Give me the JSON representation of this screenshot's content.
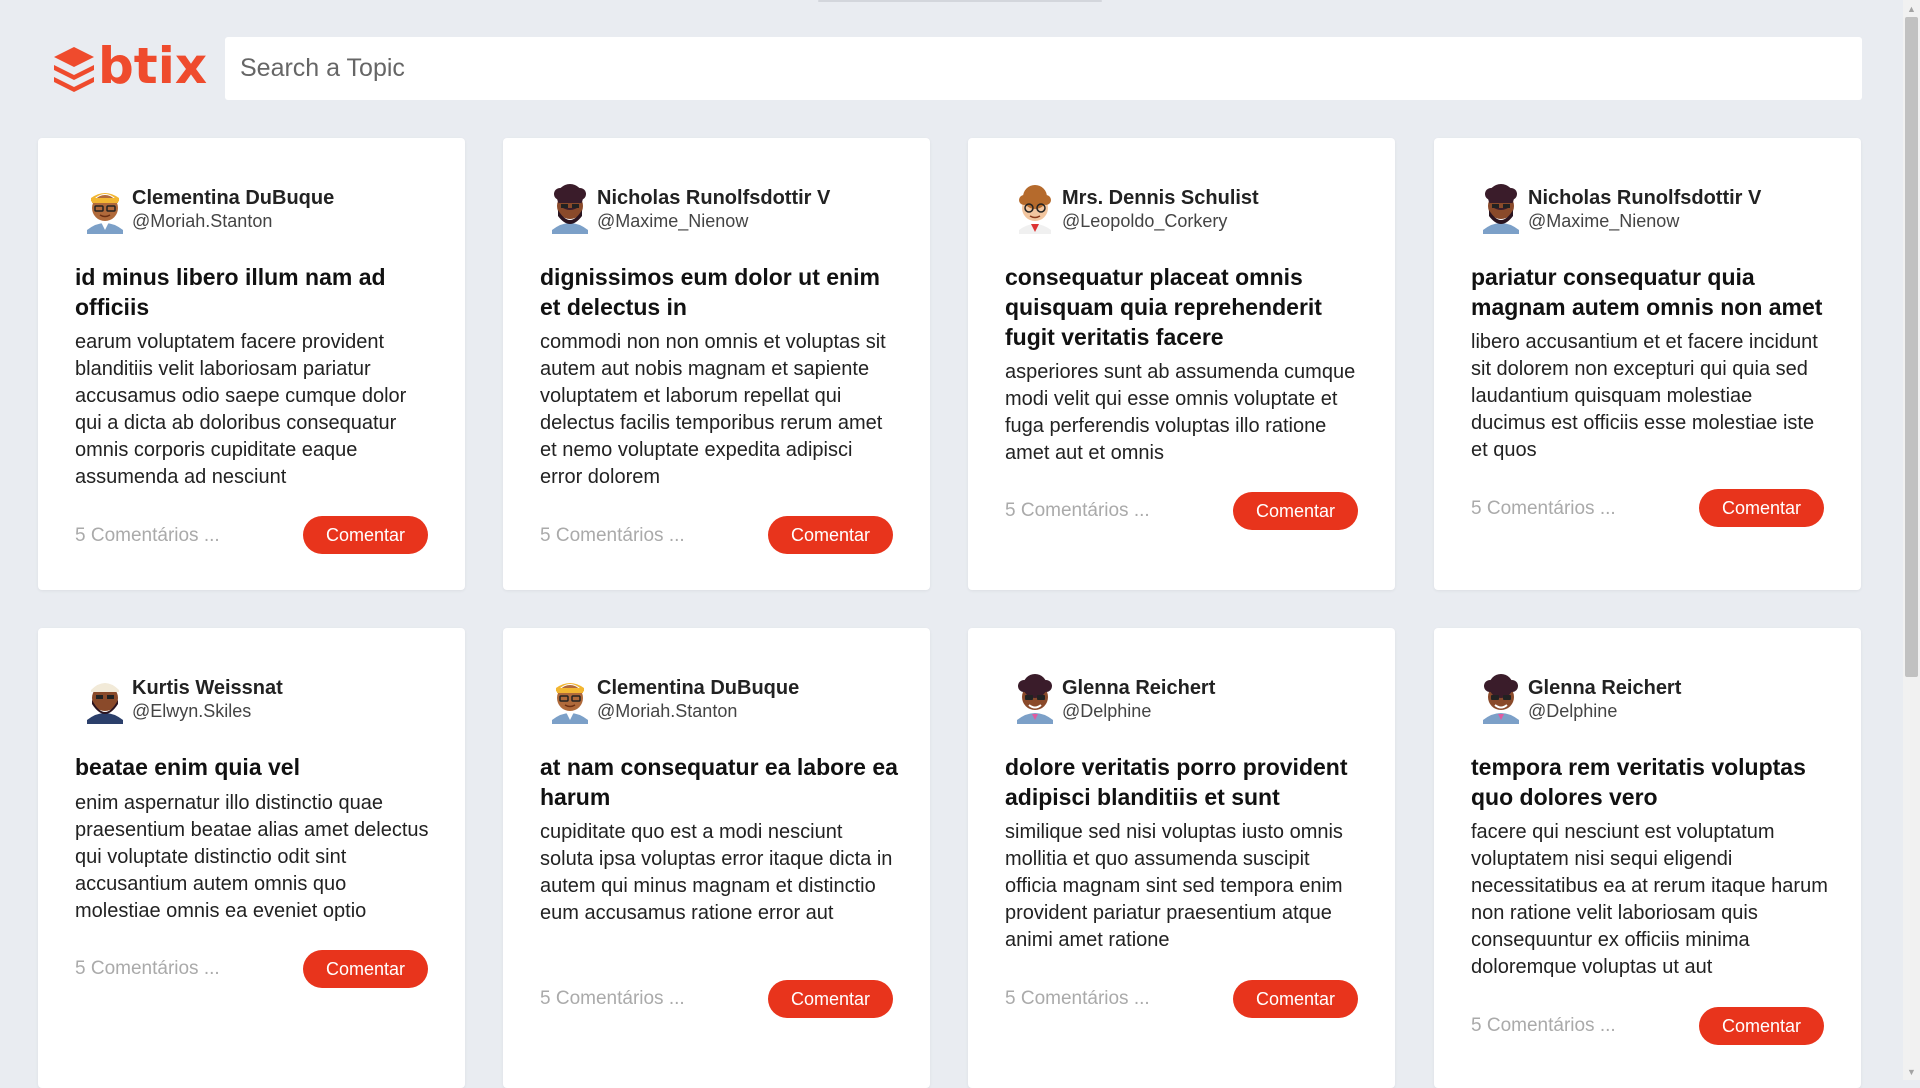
{
  "brand": {
    "logo_text": "btix",
    "accent": "#e8341c"
  },
  "search": {
    "placeholder": "Search a Topic",
    "value": ""
  },
  "posts": [
    {
      "author": "Clementina DuBuque",
      "handle": "@Moriah.Stanton",
      "title": "id minus libero illum nam ad officiis",
      "body": "earum voluptatem facere provident blanditiis velit laboriosam pariatur accusamus odio saepe cumque dolor qui a dicta ab doloribus consequatur omnis corporis cupiditate eaque assumenda ad nesciunt",
      "comments": "5 Comentários ...",
      "button": "Comentar"
    },
    {
      "author": "Nicholas Runolfsdottir V",
      "handle": "@Maxime_Nienow",
      "title": "dignissimos eum dolor ut enim et delectus in",
      "body": "commodi non non omnis et voluptas sit autem aut nobis magnam et sapiente voluptatem et laborum repellat qui delectus facilis temporibus rerum amet et nemo voluptate expedita adipisci error dolorem",
      "comments": "5 Comentários ...",
      "button": "Comentar"
    },
    {
      "author": "Mrs. Dennis Schulist",
      "handle": "@Leopoldo_Corkery",
      "title": "consequatur placeat omnis quisquam quia reprehenderit fugit veritatis facere",
      "body": "asperiores sunt ab assumenda cumque modi velit qui esse omnis voluptate et fuga perferendis voluptas illo ratione amet aut et omnis",
      "comments": "5 Comentários ...",
      "button": "Comentar"
    },
    {
      "author": "Nicholas Runolfsdottir V",
      "handle": "@Maxime_Nienow",
      "title": "pariatur consequatur quia magnam autem omnis non amet",
      "body": "libero accusantium et et facere incidunt sit dolorem non excepturi qui quia sed laudantium quisquam molestiae ducimus est officiis esse molestiae iste et quos",
      "comments": "5 Comentários ...",
      "button": "Comentar"
    },
    {
      "author": "Kurtis Weissnat",
      "handle": "@Elwyn.Skiles",
      "title": "beatae enim quia vel",
      "body": "enim aspernatur illo distinctio quae praesentium beatae alias amet delectus qui voluptate distinctio odit sint accusantium autem omnis quo molestiae omnis ea eveniet optio",
      "comments": "5 Comentários ...",
      "button": "Comentar"
    },
    {
      "author": "Clementina DuBuque",
      "handle": "@Moriah.Stanton",
      "title": "at nam consequatur ea labore ea harum",
      "body": "cupiditate quo est a modi nesciunt soluta ipsa voluptas error itaque dicta in autem qui minus magnam et distinctio eum accusamus ratione error aut",
      "comments": "5 Comentários ...",
      "button": "Comentar"
    },
    {
      "author": "Glenna Reichert",
      "handle": "@Delphine",
      "title": "dolore veritatis porro provident adipisci blanditiis et sunt",
      "body": "similique sed nisi voluptas iusto omnis mollitia et quo assumenda suscipit officia magnam sint sed tempora enim provident pariatur praesentium atque animi amet ratione",
      "comments": "5 Comentários ...",
      "button": "Comentar"
    },
    {
      "author": "Glenna Reichert",
      "handle": "@Delphine",
      "title": "tempora rem veritatis voluptas quo dolores vero",
      "body": "facere qui nesciunt est voluptatum voluptatem nisi sequi eligendi necessitatibus ea at rerum itaque harum non ratione velit laboriosam quis consequuntur ex officiis minima doloremque voluptas ut aut",
      "comments": "5 Comentários ...",
      "button": "Comentar"
    }
  ]
}
